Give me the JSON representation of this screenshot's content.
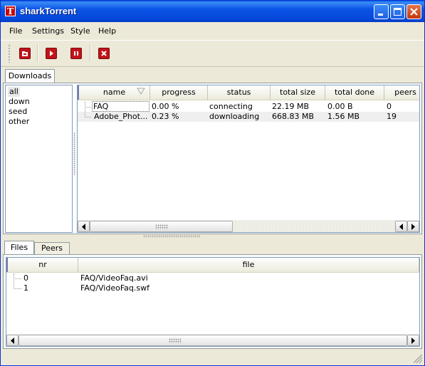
{
  "app": {
    "title": "sharkTorrent",
    "icon_letter": "T"
  },
  "menu": [
    "File",
    "Settings",
    "Style",
    "Help"
  ],
  "toolbar": {
    "buttons": [
      "open-torrent-icon",
      "start-icon",
      "pause-icon",
      "remove-icon"
    ],
    "accent": "#c0141a"
  },
  "top_tabs": [
    "Downloads"
  ],
  "categories": [
    "all",
    "down",
    "seed",
    "other"
  ],
  "downloads": {
    "columns": [
      "name",
      "progress",
      "status",
      "total size",
      "total done",
      "peers"
    ],
    "rows": [
      [
        "FAQ",
        "0.00 %",
        "connecting",
        "22.19 MB",
        "0.00 B",
        "0"
      ],
      [
        "Adobe_Phot...",
        "0.23 %",
        "downloading",
        "668.83 MB",
        "1.56 MB",
        "19"
      ]
    ]
  },
  "bottom_tabs": [
    "Files",
    "Peers"
  ],
  "files": {
    "columns": [
      "nr",
      "file"
    ],
    "rows": [
      [
        "0",
        "FAQ/VideoFaq.avi"
      ],
      [
        "1",
        "FAQ/VideoFaq.swf"
      ]
    ]
  }
}
